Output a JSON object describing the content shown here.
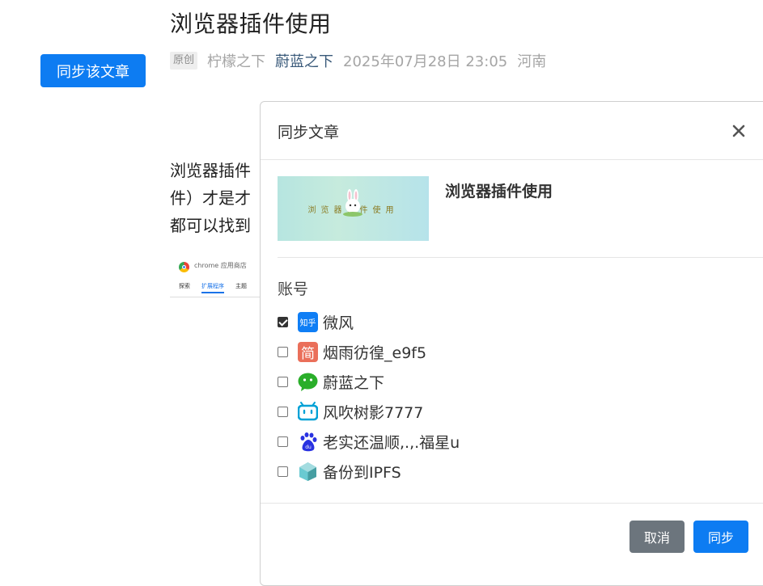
{
  "article": {
    "title": "浏览器插件使用",
    "badge": "原创",
    "author1": "柠檬之下",
    "author2": "蔚蓝之下",
    "date": "2025年07月28日 23:05",
    "location": "河南",
    "body_lines": [
      "浏览器插件",
      "件）才是才",
      "都可以找到"
    ],
    "thumb_store": "chrome 应用商店",
    "thumb_tabs": [
      "探索",
      "扩展程序",
      "主题"
    ]
  },
  "sync_article_button": "同步该文章",
  "modal": {
    "title": "同步文章",
    "post_title": "浏览器插件使用",
    "cover_text": "浏览器插件使用",
    "account_label": "账号",
    "accounts": [
      {
        "platform": "zhihu",
        "icon": "zhihu-icon",
        "icon_text": "知乎",
        "name": "微风",
        "checked": true
      },
      {
        "platform": "jianshu",
        "icon": "jianshu-icon",
        "icon_text": "简",
        "name": "烟雨彷徨_e9f5",
        "checked": false
      },
      {
        "platform": "wechat",
        "icon": "wechat-icon",
        "name": "蔚蓝之下",
        "checked": false
      },
      {
        "platform": "bilibili",
        "icon": "bilibili-icon",
        "name": "风吹树影7777",
        "checked": false
      },
      {
        "platform": "baidu",
        "icon": "baidu-paw-icon",
        "name": "老实还温顺,.,.福星u",
        "checked": false
      },
      {
        "platform": "ipfs",
        "icon": "ipfs-cube-icon",
        "name": "备份到IPFS",
        "checked": false
      }
    ],
    "cancel_label": "取消",
    "sync_label": "同步"
  },
  "colors": {
    "primary": "#0d7cf2",
    "secondary": "#6c757d",
    "zhihu": "#0f7ef5",
    "jianshu": "#ea6f5a",
    "wechat": "#2aae2a",
    "bilibili": "#00a1d6",
    "baidu": "#2932e1",
    "ipfs": "#469ea2"
  }
}
